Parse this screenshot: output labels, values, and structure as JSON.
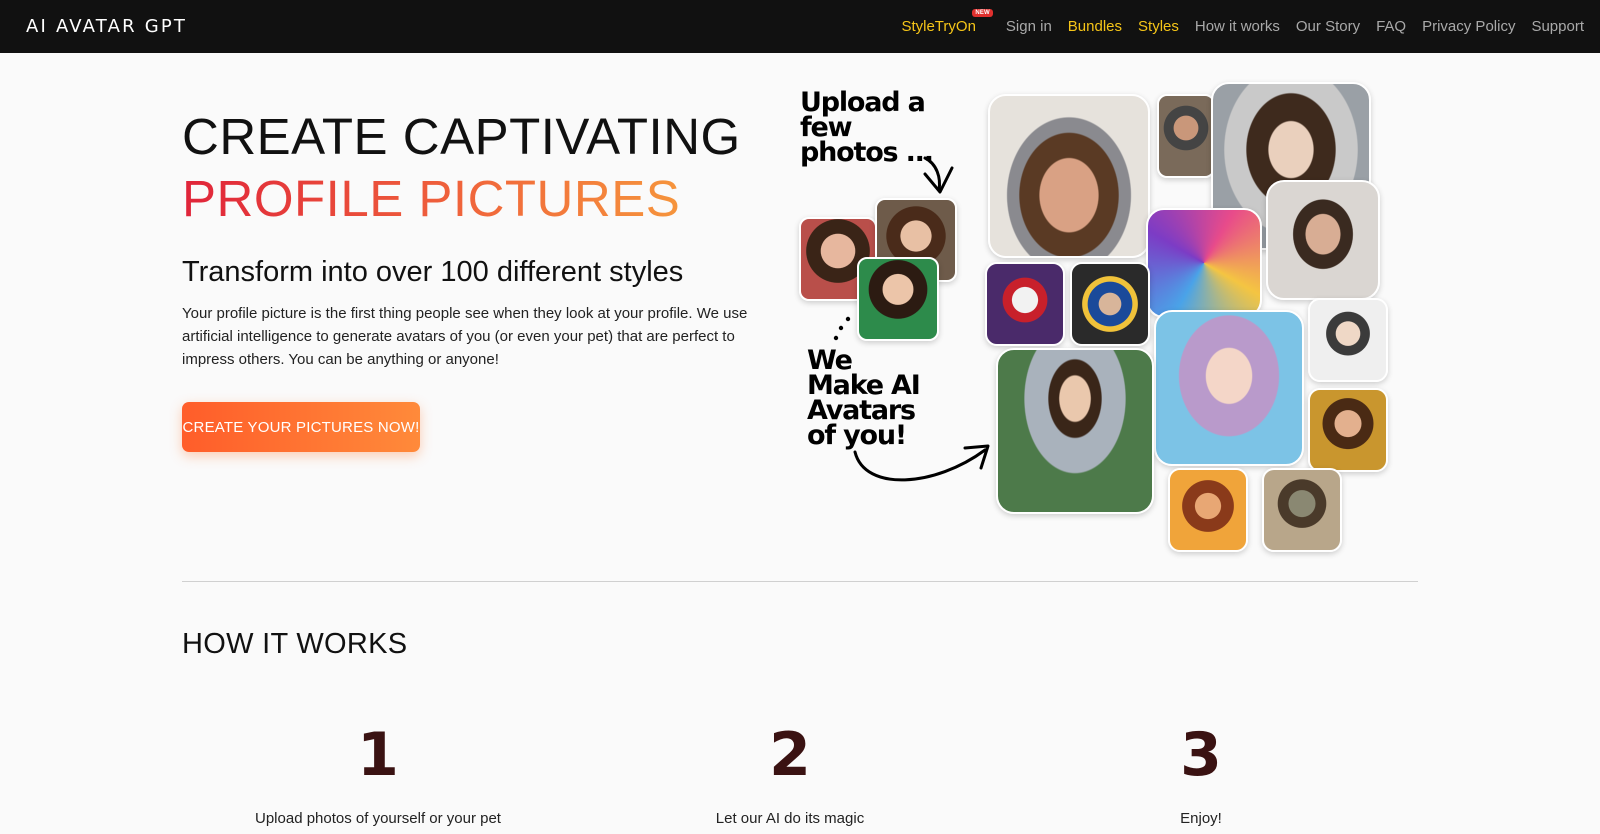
{
  "nav": {
    "brand": "AI AVATAR GPT",
    "badge": "NEW",
    "links": [
      {
        "label": "StyleTryOn",
        "style": "gold"
      },
      {
        "label": "Sign in",
        "style": "muted"
      },
      {
        "label": "Bundles",
        "style": "gold"
      },
      {
        "label": "Styles",
        "style": "gold"
      },
      {
        "label": "How it works",
        "style": "muted"
      },
      {
        "label": "Our Story",
        "style": "muted"
      },
      {
        "label": "FAQ",
        "style": "muted"
      },
      {
        "label": "Privacy Policy",
        "style": "muted"
      },
      {
        "label": "Support",
        "style": "muted"
      }
    ]
  },
  "hero": {
    "title_line1": "CREATE CAPTIVATING",
    "title_line2": "PROFILE PICTURES",
    "subtitle": "Transform into over 100 different styles",
    "description": "Your profile picture is the first thing people see when they look at your profile. We use artificial intelligence to generate avatars of you (or even your pet) that are perfect to impress others. You can be anything or anyone!",
    "cta_label": "CREATE YOUR PICTURES NOW!"
  },
  "collage": {
    "upload_text": [
      "Upload a",
      "few",
      "photos ..."
    ],
    "make_text": [
      "We",
      "Make AI",
      "Avatars",
      "of you!"
    ]
  },
  "how_it_works": {
    "title": "HOW IT WORKS",
    "steps": [
      {
        "number": "1",
        "label": "Upload photos of yourself or your pet"
      },
      {
        "number": "2",
        "label": "Let our AI do its magic"
      },
      {
        "number": "3",
        "label": "Enjoy!"
      }
    ]
  },
  "colors": {
    "nav_bg": "#111111",
    "gold": "#f5c518",
    "gradient_start": "#e0243a",
    "gradient_end": "#f7a23c",
    "cta": "#ff6a30",
    "step_number": "#3a1212"
  }
}
